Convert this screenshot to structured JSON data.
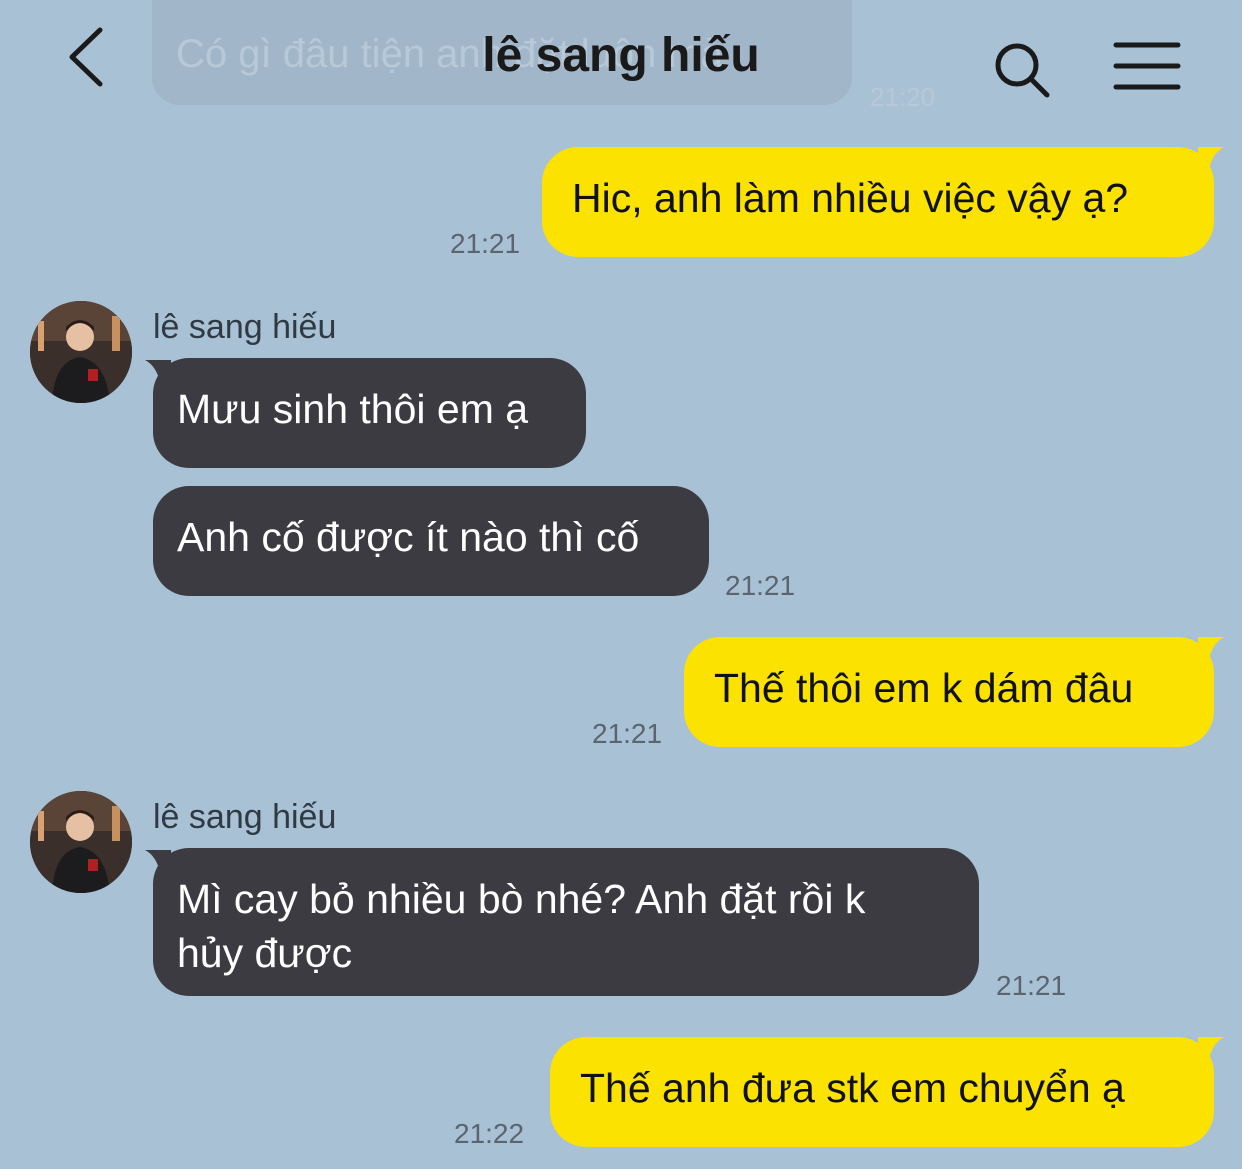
{
  "header": {
    "title": "lê sang hiếu"
  },
  "previous_message": {
    "text": "Có gì đâu tiện anh đặt luôn mà",
    "time": "21:20"
  },
  "messages": [
    {
      "side": "me",
      "text": "Hic, anh làm nhiều việc vậy ạ?",
      "time": "21:21"
    },
    {
      "side": "them",
      "sender": "lê sang hiếu",
      "text": "Mưu sinh thôi em ạ"
    },
    {
      "side": "them",
      "text": "Anh cố được ít nào thì cố",
      "time": "21:21"
    },
    {
      "side": "me",
      "text": "Thế thôi em k dám đâu",
      "time": "21:21"
    },
    {
      "side": "them",
      "sender": "lê sang hiếu",
      "text": "Mì cay bỏ nhiều bò nhé? Anh đặt rồi k hủy được",
      "time": "21:21"
    },
    {
      "side": "me",
      "text": "Thế anh đưa stk em chuyển ạ",
      "time": "21:22"
    }
  ],
  "colors": {
    "background": "#a9c1d4",
    "my_bubble": "#fbe200",
    "their_bubble": "#3b3b41"
  },
  "icons": {
    "back": "chevron-left-icon",
    "search": "search-icon",
    "menu": "hamburger-menu-icon"
  }
}
